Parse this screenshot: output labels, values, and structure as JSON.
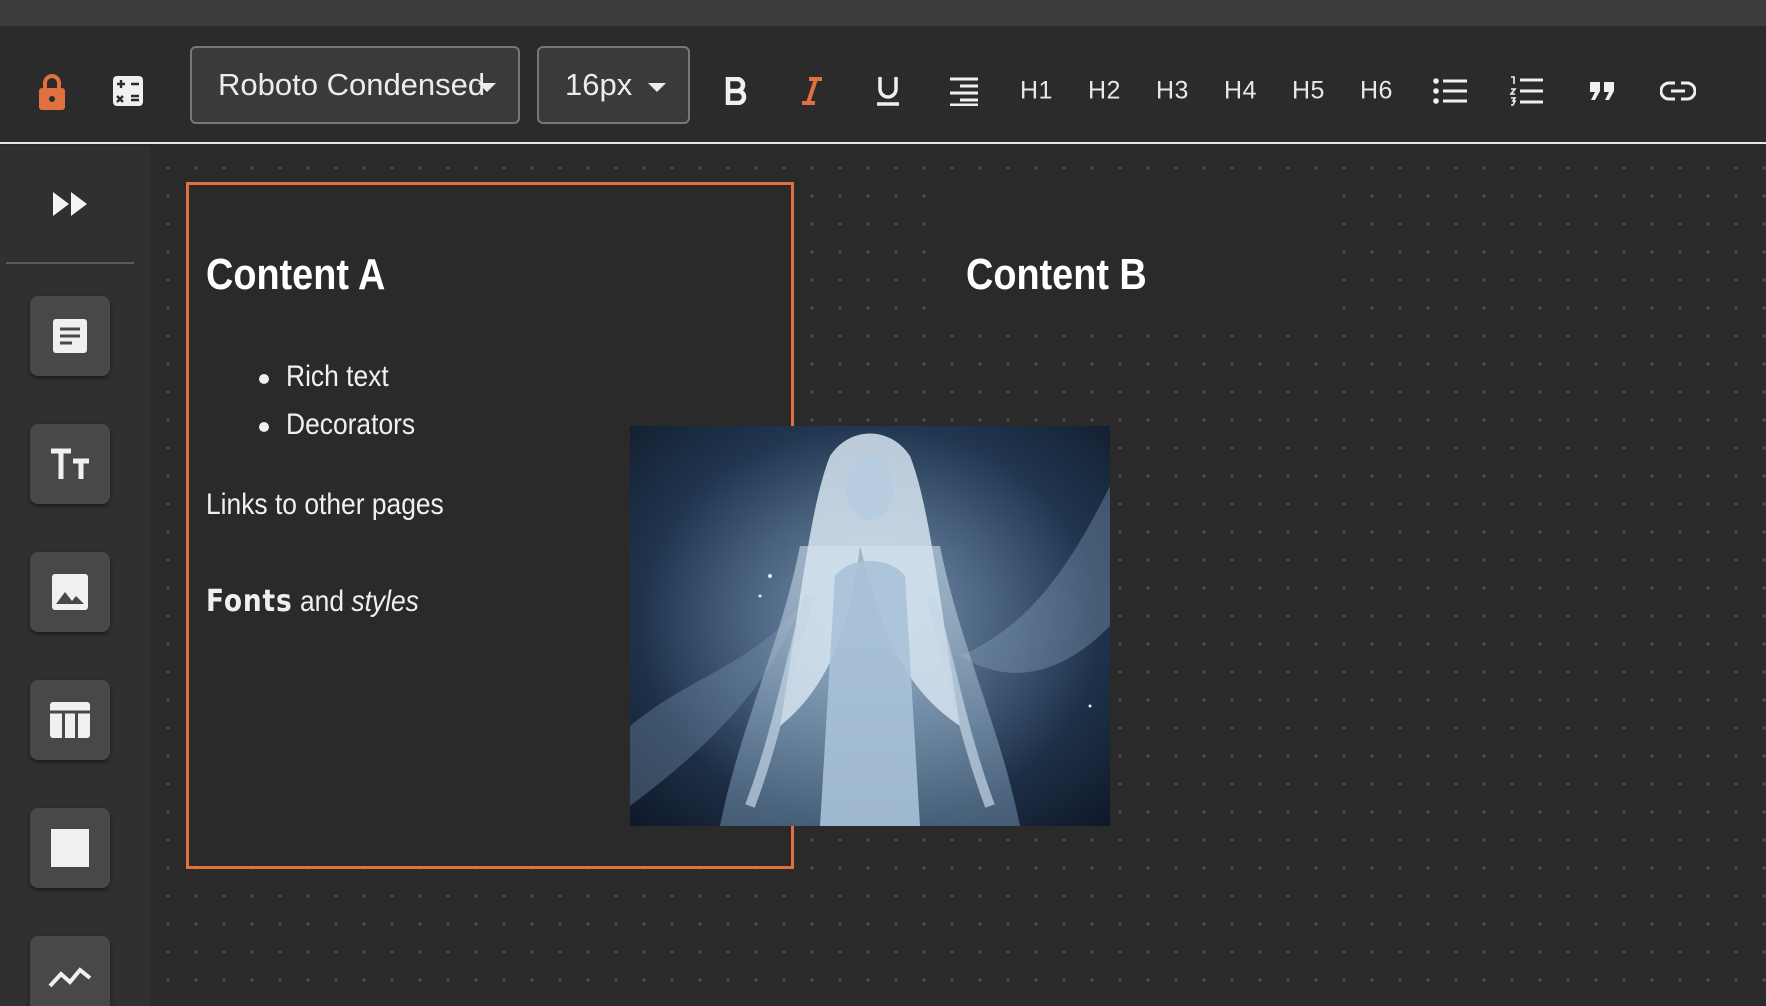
{
  "toolbar": {
    "font_family": "Roboto Condensed",
    "font_size": "16px",
    "headings": [
      "H1",
      "H2",
      "H3",
      "H4",
      "H5",
      "H6"
    ],
    "icons": [
      "lock-icon",
      "calculator-icon",
      "bold-icon",
      "italic-icon",
      "underline-icon",
      "align-right-icon",
      "bullet-list-icon",
      "numbered-list-icon",
      "quote-icon",
      "link-icon"
    ]
  },
  "sidebar": {
    "icons": [
      "expand-icon",
      "text-block-icon",
      "text-size-icon",
      "image-icon",
      "table-icon",
      "square-icon",
      "chart-line-icon"
    ]
  },
  "content_a": {
    "title": "Content A",
    "bullets": [
      "Rich text",
      "Decorators"
    ],
    "links_text": "Links to other pages",
    "fonts_word": "Fonts",
    "and_word": "and",
    "styles_word": "styles"
  },
  "content_b": {
    "title": "Content B"
  },
  "colors": {
    "accent": "#e07040",
    "background": "#2a2a2a",
    "toolbar": "#2b2b2b",
    "sidebar": "#303030"
  }
}
